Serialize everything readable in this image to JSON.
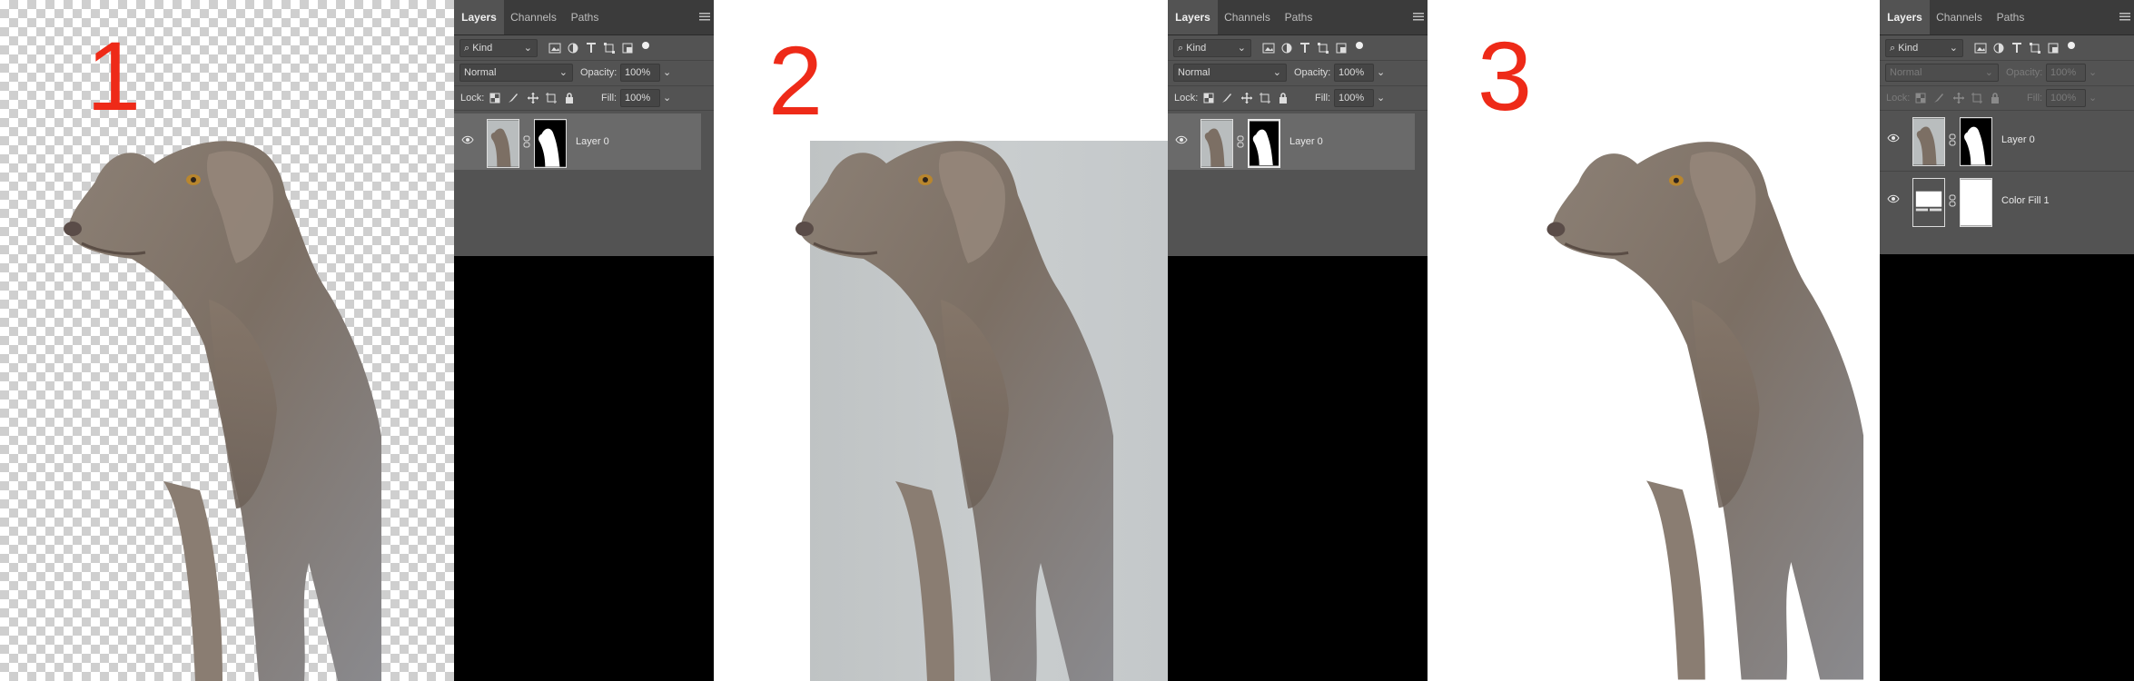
{
  "steps": [
    {
      "number": "1",
      "canvas": "transparent",
      "panel": {
        "tabs": [
          "Layers",
          "Channels",
          "Paths"
        ],
        "active_tab": "Layers",
        "filter_kind": "Kind",
        "blend_mode": "Normal",
        "opacity_label": "Opacity:",
        "opacity_value": "100%",
        "lock_label": "Lock:",
        "fill_label": "Fill:",
        "fill_value": "100%",
        "disabled": false,
        "layers": [
          {
            "name": "Layer 0",
            "visible": true,
            "selected": true,
            "type": "mask"
          }
        ]
      }
    },
    {
      "number": "2",
      "canvas": "white",
      "panel": {
        "tabs": [
          "Layers",
          "Channels",
          "Paths"
        ],
        "active_tab": "Layers",
        "filter_kind": "Kind",
        "blend_mode": "Normal",
        "opacity_label": "Opacity:",
        "opacity_value": "100%",
        "lock_label": "Lock:",
        "fill_label": "Fill:",
        "fill_value": "100%",
        "disabled": false,
        "layers": [
          {
            "name": "Layer 0",
            "visible": true,
            "selected": true,
            "type": "mask"
          }
        ]
      }
    },
    {
      "number": "3",
      "canvas": "white",
      "panel": {
        "tabs": [
          "Layers",
          "Channels",
          "Paths"
        ],
        "active_tab": "Layers",
        "filter_kind": "Kind",
        "blend_mode": "Normal",
        "opacity_label": "Opacity:",
        "opacity_value": "100%",
        "lock_label": "Lock:",
        "fill_label": "Fill:",
        "fill_value": "100%",
        "disabled": true,
        "layers": [
          {
            "name": "Layer 0",
            "visible": true,
            "selected": false,
            "type": "mask"
          },
          {
            "name": "Color Fill 1",
            "visible": true,
            "selected": false,
            "type": "fill"
          }
        ]
      }
    }
  ],
  "colors": {
    "step_number": "#ee2a18",
    "panel_bg": "#535353",
    "panel_tabs_bg": "#3b3b3b",
    "selected_layer": "#6a6a6a"
  }
}
